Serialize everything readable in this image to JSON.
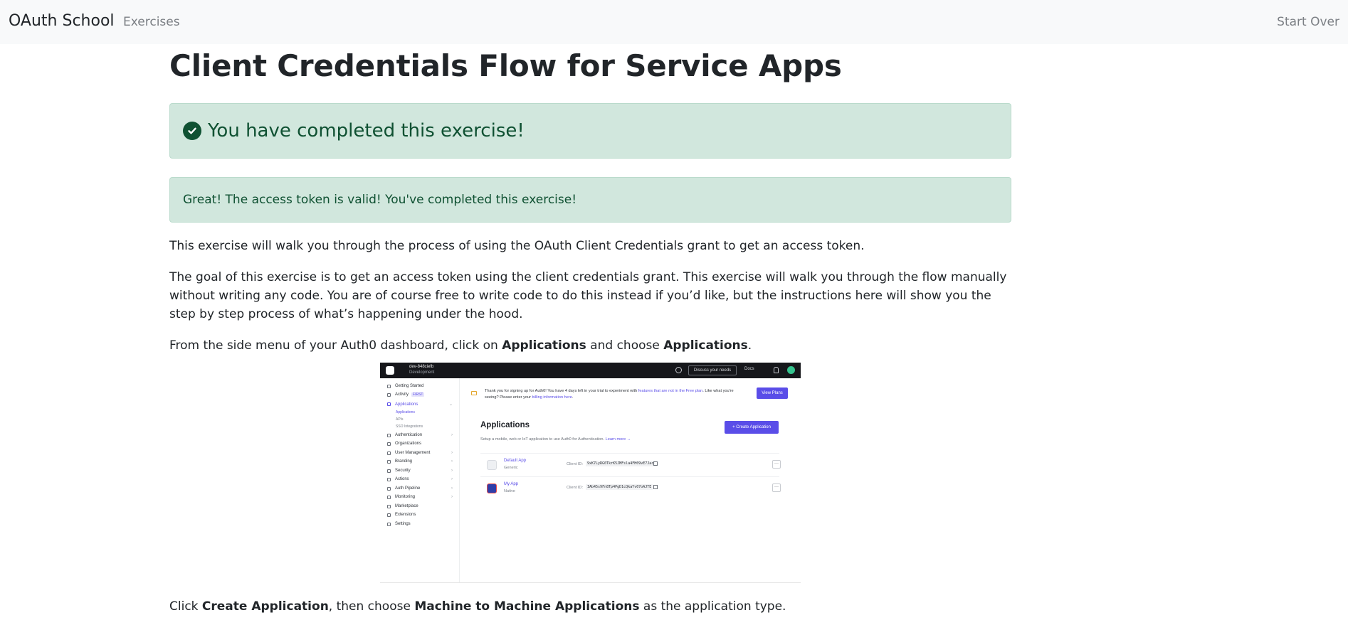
{
  "navbar": {
    "brand": "OAuth School",
    "exercises_link": "Exercises",
    "start_over": "Start Over"
  },
  "page": {
    "title": "Client Credentials Flow for Service Apps",
    "completed_banner": "You have completed this exercise!",
    "success_message": "Great! The access token is valid! You've completed this exercise!",
    "intro": "This exercise will walk you through the process of using the OAuth Client Credentials grant to get an access token.",
    "goal": "The goal of this exercise is to get an access token using the client credentials grant. This exercise will walk you through the flow manually without writing any code. You are of course free to write code to do this instead if you’d like, but the instructions here will show you the step by step process of what’s happening under the hood.",
    "step1": {
      "before": "From the side menu of your Auth0 dashboard, click on ",
      "bold1": "Applications",
      "middle": " and choose ",
      "bold2": "Applications",
      "after": "."
    },
    "step2": {
      "before": "Click ",
      "bold1": "Create Application",
      "middle": ", then choose ",
      "bold2": "Machine to Machine Applications",
      "after": " as the application type."
    }
  },
  "screenshot": {
    "tenant": "dev-848ciefb",
    "tenant_env": "Development",
    "discuss": "Discuss your needs",
    "docs": "Docs",
    "sidebar": [
      {
        "label": "Getting Started",
        "chevron": ""
      },
      {
        "label": "Activity",
        "badge": "FIRST",
        "chevron": ""
      },
      {
        "label": "Applications",
        "chevron": "⌄"
      },
      {
        "label": "Authentication",
        "chevron": "›"
      },
      {
        "label": "Organizations",
        "chevron": ""
      },
      {
        "label": "User Management",
        "chevron": "›"
      },
      {
        "label": "Branding",
        "chevron": "›"
      },
      {
        "label": "Security",
        "chevron": "›"
      },
      {
        "label": "Actions",
        "chevron": "›"
      },
      {
        "label": "Auth Pipeline",
        "chevron": "›"
      },
      {
        "label": "Monitoring",
        "chevron": "›"
      },
      {
        "label": "Marketplace",
        "chevron": ""
      },
      {
        "label": "Extensions",
        "chevron": ""
      },
      {
        "label": "Settings",
        "chevron": ""
      }
    ],
    "sub_items": [
      "Applications",
      "APIs",
      "SSO Integrations"
    ],
    "banner": {
      "text_a": "Thank you for signing up for Auth0! You have 4 days left in your trial to experiment with ",
      "link_a": "features that are not in the Free plan",
      "text_b": ". Like what you're seeing? Please enter your ",
      "link_b": "billing information here",
      "text_c": ".",
      "button": "View Plans"
    },
    "apps_title": "Applications",
    "apps_sub": "Setup a mobile, web or IoT application to use Auth0 for Authentication.",
    "apps_learn": "Learn more →",
    "create_button": "+ Create Application",
    "client_id_label": "Client ID:",
    "apps": [
      {
        "name": "Default App",
        "type": "Generic",
        "client_id": "9xK7LyRG0TkrK5JMFsla4FH09vE7Jac"
      },
      {
        "name": "My App",
        "type": "Native",
        "client_id": "IAb45s9Fn8Tp4PgD1cQkaYv07oAJTE"
      }
    ]
  }
}
